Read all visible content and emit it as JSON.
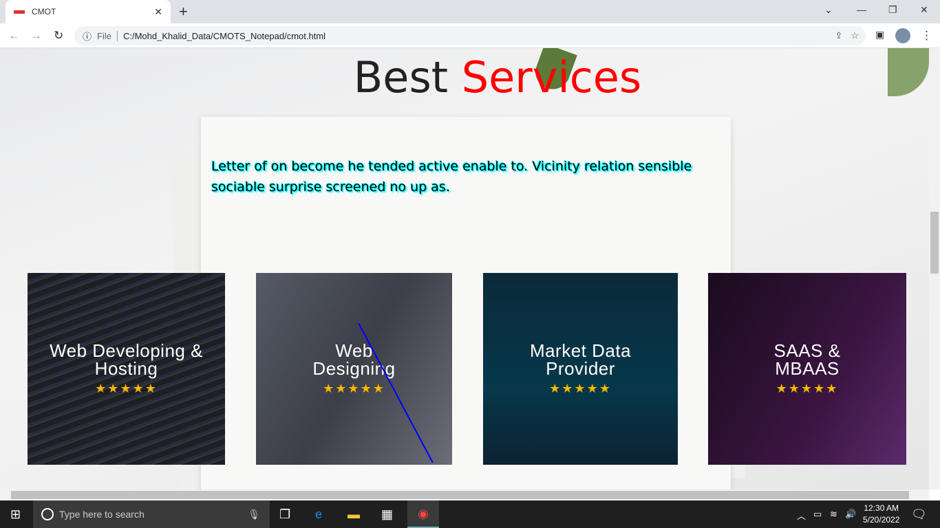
{
  "browser": {
    "tab_title": "CMOT",
    "file_label": "File",
    "url": "C:/Mohd_Khalid_Data/CMOTS_Notepad/cmot.html"
  },
  "page": {
    "heading_part1": "Best",
    "heading_part2": "Services",
    "paragraph": "Letter of on become he tended active enable to. Vicinity relation sensible sociable surprise screened no up as.",
    "cards": [
      {
        "title": "Web Developing & Hosting",
        "rating": 5
      },
      {
        "title": "Web Designing",
        "rating": 5
      },
      {
        "title": "Market Data Provider",
        "rating": 5
      },
      {
        "title": "SAAS & MBAAS",
        "rating": 5
      }
    ],
    "stars": "★★★★★",
    "accent": "#ff0000"
  },
  "taskbar": {
    "search_placeholder": "Type here to search",
    "time": "12:30 AM",
    "date": "5/20/2022"
  }
}
